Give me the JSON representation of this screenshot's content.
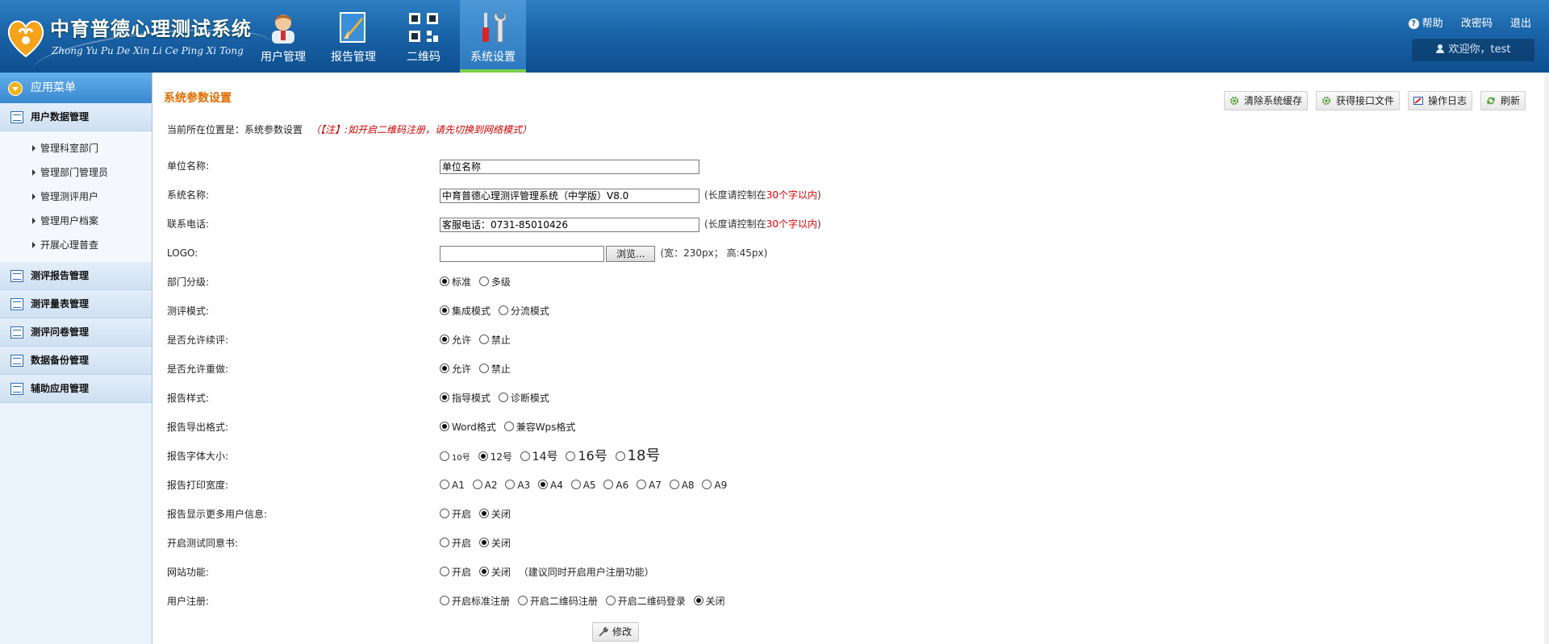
{
  "header": {
    "title": "中育普德心理测试系统",
    "subtitle": "Zhong Yu Pu De Xin Li Ce Ping Xi Tong",
    "nav": [
      {
        "label": "用户管理",
        "icon": "user-icon",
        "active": false
      },
      {
        "label": "报告管理",
        "icon": "report-icon",
        "active": false
      },
      {
        "label": "二维码",
        "icon": "qrcode-icon",
        "active": false
      },
      {
        "label": "系统设置",
        "icon": "tools-icon",
        "active": true
      }
    ],
    "links": {
      "help": "帮助",
      "change_password": "改密码",
      "logout": "退出"
    },
    "welcome": "欢迎你，test"
  },
  "sidebar": {
    "title": "应用菜单",
    "groups": [
      {
        "label": "用户数据管理",
        "items": [
          "管理科室部门",
          "管理部门管理员",
          "管理测评用户",
          "管理用户档案",
          "开展心理普查"
        ]
      },
      {
        "label": "测评报告管理"
      },
      {
        "label": "测评量表管理"
      },
      {
        "label": "测评问卷管理"
      },
      {
        "label": "数据备份管理"
      },
      {
        "label": "辅助应用管理"
      }
    ]
  },
  "main": {
    "page_title": "系统参数设置",
    "toolbar": {
      "clear_cache": "清除系统缓存",
      "get_api_file": "获得接口文件",
      "operation_log": "操作日志",
      "refresh": "刷新"
    },
    "location_label": "当前所在位置是：系统参数设置",
    "location_note": "（【注】:如开启二维码注册，请先切换到网络模式）",
    "form": {
      "unit_name": {
        "label": "单位名称:",
        "value": "单位名称"
      },
      "system_name": {
        "label": "系统名称:",
        "value": "中育普德心理测评管理系统（中学版）V8.0",
        "hint_pre": "(长度请控制在",
        "hint_num": "30个字以内",
        "hint_post": ")"
      },
      "phone": {
        "label": "联系电话:",
        "value": "客服电话：0731-85010426",
        "hint_pre": "(长度请控制在",
        "hint_num": "30个字以内",
        "hint_post": ")"
      },
      "logo": {
        "label": "LOGO:",
        "browse": "浏览...",
        "hint": "(宽：230px； 高:45px)"
      },
      "department_level": {
        "label": "部门分级:",
        "options": [
          "标准",
          "多级"
        ],
        "selected": 0
      },
      "test_mode": {
        "label": "测评模式:",
        "options": [
          "集成模式",
          "分流模式"
        ],
        "selected": 0
      },
      "allow_continue": {
        "label": "是否允许续评:",
        "options": [
          "允许",
          "禁止"
        ],
        "selected": 0
      },
      "allow_redo": {
        "label": "是否允许重做:",
        "options": [
          "允许",
          "禁止"
        ],
        "selected": 0
      },
      "report_style": {
        "label": "报告样式:",
        "options": [
          "指导模式",
          "诊断模式"
        ],
        "selected": 0
      },
      "export_format": {
        "label": "报告导出格式:",
        "options": [
          "Word格式",
          "兼容Wps格式"
        ],
        "selected": 0
      },
      "font_size": {
        "label": "报告字体大小:",
        "options": [
          "10号",
          "12号",
          "14号",
          "16号",
          "18号"
        ],
        "selected": 1
      },
      "print_width": {
        "label": "报告打印宽度:",
        "options": [
          "A1",
          "A2",
          "A3",
          "A4",
          "A5",
          "A6",
          "A7",
          "A8",
          "A9"
        ],
        "selected": 3
      },
      "show_user_info": {
        "label": "报告显示更多用户信息:",
        "options": [
          "开启",
          "关闭"
        ],
        "selected": 1
      },
      "consent_form": {
        "label": "开启测试同意书:",
        "options": [
          "开启",
          "关闭"
        ],
        "selected": 1
      },
      "website": {
        "label": "网站功能:",
        "options": [
          "开启",
          "关闭"
        ],
        "selected": 1,
        "hint": "（建议同时开启用户注册功能）"
      },
      "registration": {
        "label": "用户注册:",
        "options": [
          "开启标准注册",
          "开启二维码注册",
          "开启二维码登录",
          "关闭"
        ],
        "selected": 3
      }
    },
    "save_label": "修改"
  },
  "colors": {
    "accent": "#e06b00",
    "header": "#1a64a8",
    "active_bar": "#7cd14a",
    "hint_red": "#d00"
  }
}
